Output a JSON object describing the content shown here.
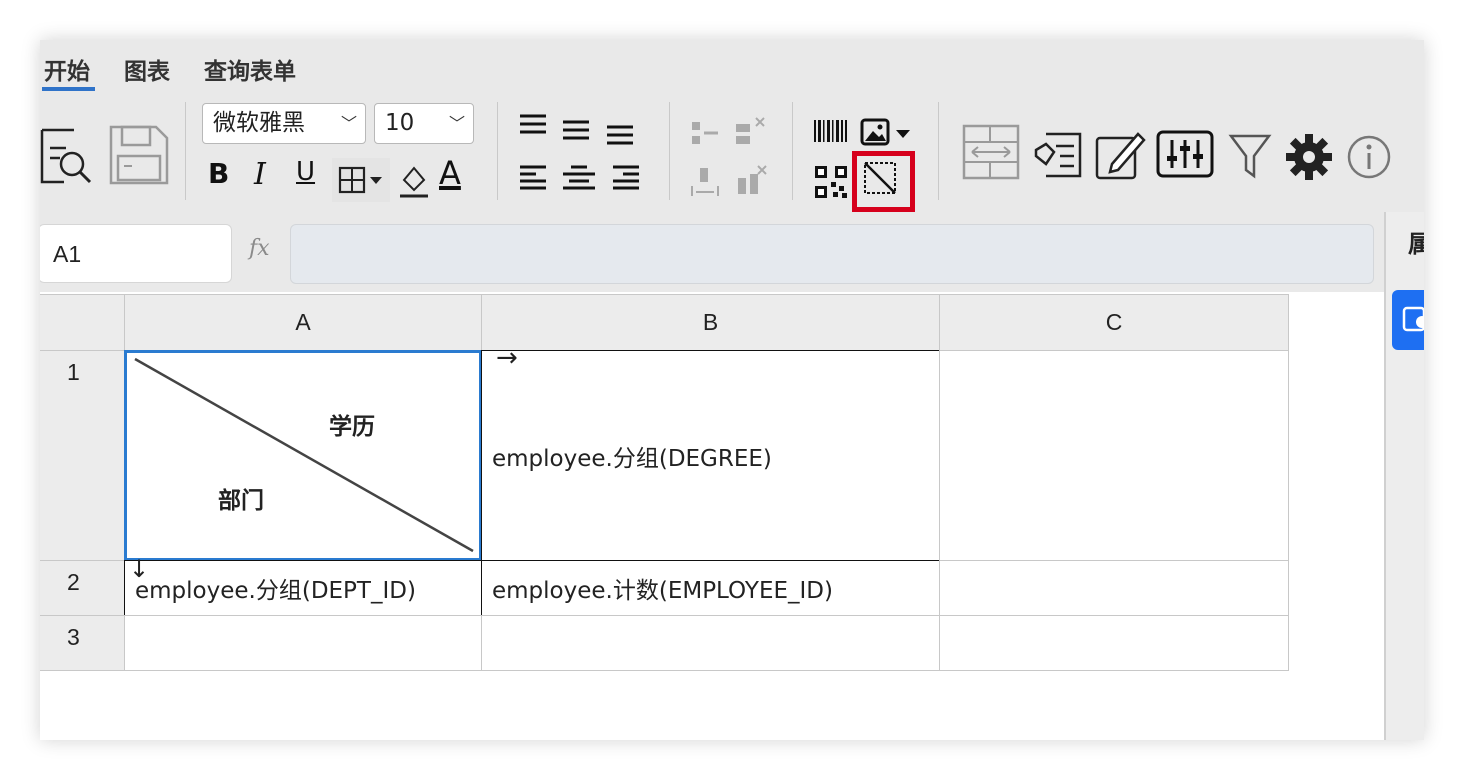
{
  "tabs": [
    "开始",
    "图表",
    "查询表单"
  ],
  "active_tab": "开始",
  "toolbar": {
    "font_family": "微软雅黑",
    "font_size": "10",
    "bold_label": "B",
    "italic_label": "I",
    "underline_label": "U",
    "font_color_label": "A",
    "icons": [
      "preview-icon",
      "save-icon",
      "bold-icon",
      "italic-icon",
      "underline-icon",
      "borders-icon",
      "fill-color-icon",
      "font-color-icon",
      "align-top-icon",
      "align-middle-icon",
      "align-bottom-icon",
      "align-left-icon",
      "align-center-icon",
      "align-right-icon",
      "insert-row-icon",
      "delete-row-icon",
      "insert-col-icon",
      "delete-col-icon",
      "barcode-icon",
      "image-icon",
      "qrcode-icon",
      "slash-cell-icon",
      "row-resize-icon",
      "form-icon",
      "edit-icon",
      "settings-sliders-icon",
      "filter-icon",
      "gear-icon",
      "info-icon"
    ]
  },
  "formula_bar": {
    "cell_ref": "A1",
    "fx_label": "fx",
    "formula": ""
  },
  "grid": {
    "columns": [
      "A",
      "B",
      "C"
    ],
    "rows": [
      "1",
      "2",
      "3"
    ],
    "cells": {
      "A1_top_right": "学历",
      "A1_bottom_left": "部门",
      "B1_arrow": "→",
      "B1": "employee.分组(DEGREE)",
      "A2_arrow": "↓",
      "A2": "employee.分组(DEPT_ID)",
      "B2": "employee.计数(EMPLOYEE_ID)"
    }
  },
  "right_panel": {
    "title": "属"
  },
  "colors": {
    "accent": "#2f73c9",
    "highlight": "#d6001c",
    "panel_button": "#1e6ff2",
    "selection": "#2a7bd0"
  }
}
